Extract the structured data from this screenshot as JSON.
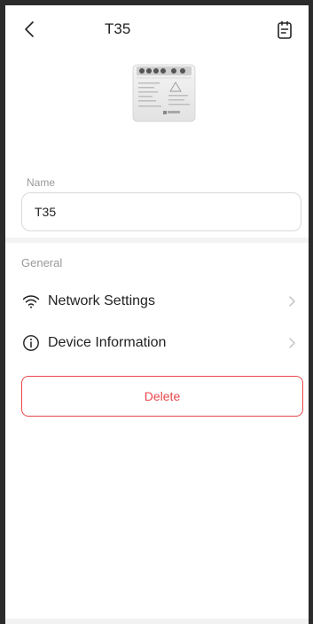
{
  "header": {
    "title": "T35",
    "back_icon": "chevron-left-icon",
    "log_icon": "log-document-icon"
  },
  "device": {
    "image_icon": "smart-relay-device-image"
  },
  "name_field": {
    "label": "Name",
    "value": "T35"
  },
  "general": {
    "section_title": "General",
    "items": [
      {
        "label": "Network Settings",
        "icon": "wifi-icon"
      },
      {
        "label": "Device Information",
        "icon": "info-circle-icon"
      }
    ]
  },
  "actions": {
    "delete_label": "Delete"
  },
  "colors": {
    "danger": "#e8474b",
    "muted_text": "#999999",
    "separator": "#f3f3f3"
  }
}
